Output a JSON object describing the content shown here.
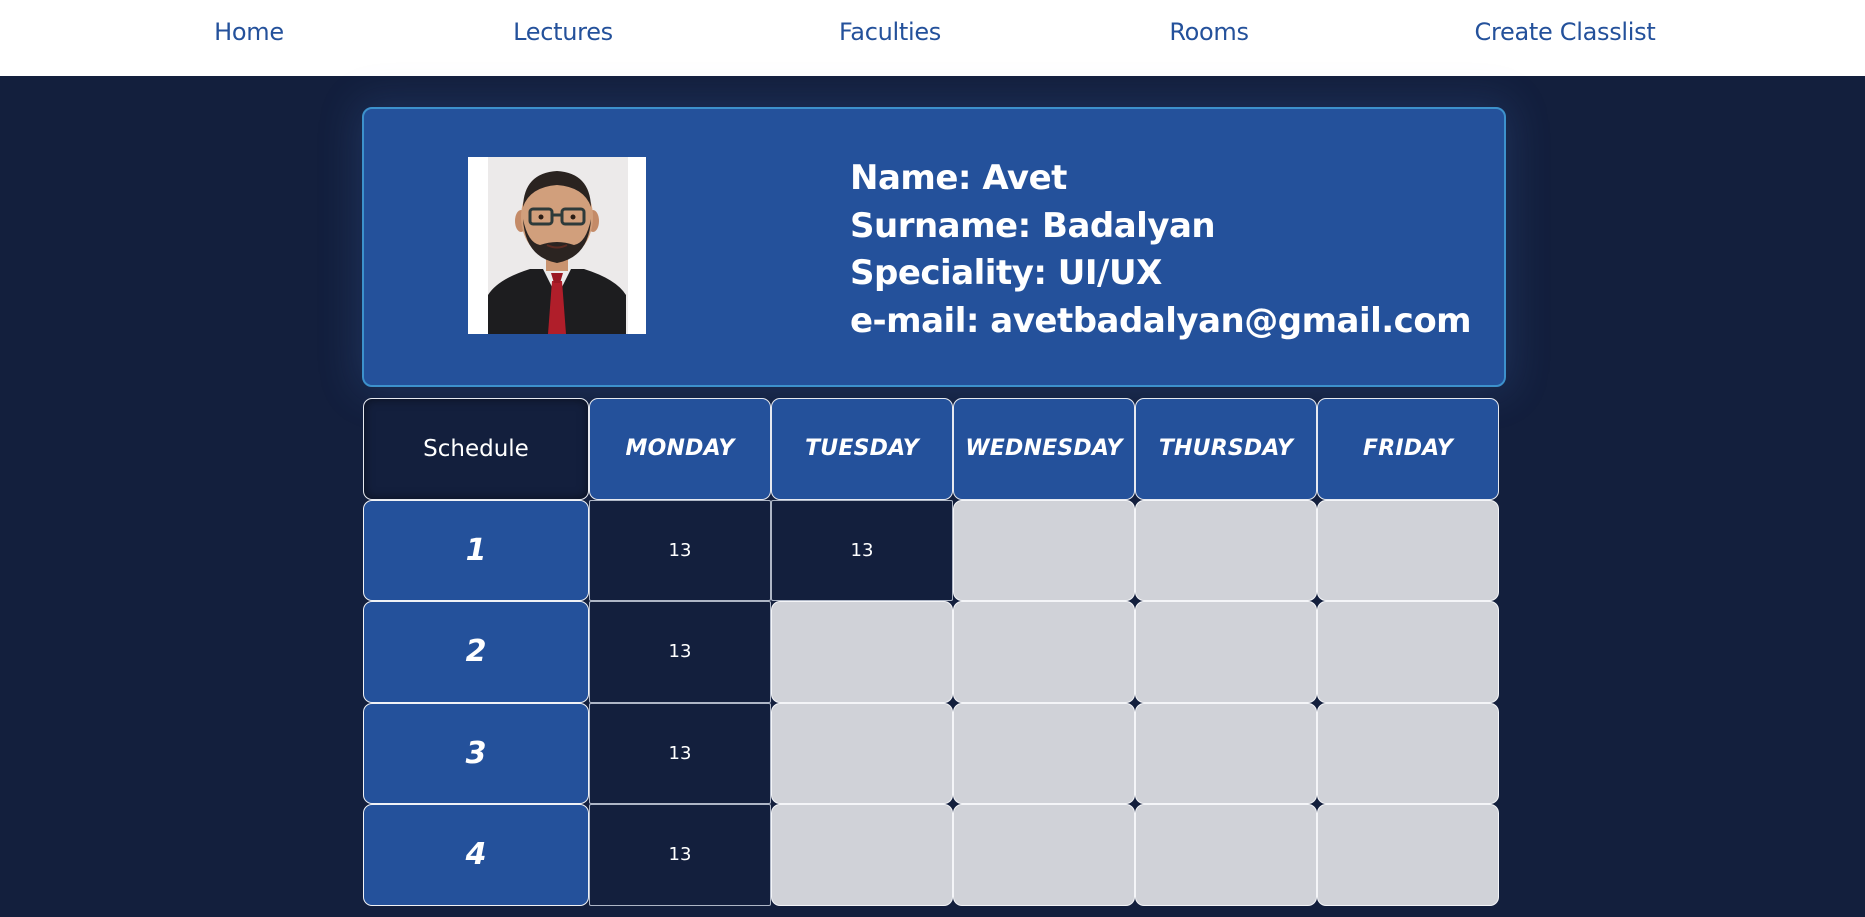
{
  "nav": {
    "home": "Home",
    "lectures": "Lectures",
    "faculties": "Faculties",
    "rooms": "Rooms",
    "create_classlist": "Create Classlist"
  },
  "profile": {
    "avatar_icon": "person-photo",
    "name_line": "Name: Avet",
    "surname_line": "Surname: Badalyan",
    "speciality_line": "Speciality: UI/UX",
    "email_line": "e-mail: avetbadalyan@gmail.com"
  },
  "schedule": {
    "corner_label": "Schedule",
    "days": [
      "MONDAY",
      "TUESDAY",
      "WEDNESDAY",
      "THURSDAY",
      "FRIDAY"
    ],
    "rows": [
      {
        "label": "1",
        "cells": [
          "13",
          "13",
          "",
          "",
          ""
        ]
      },
      {
        "label": "2",
        "cells": [
          "13",
          "",
          "",
          "",
          ""
        ]
      },
      {
        "label": "3",
        "cells": [
          "13",
          "",
          "",
          "",
          ""
        ]
      },
      {
        "label": "4",
        "cells": [
          "13",
          "",
          "",
          "",
          ""
        ]
      }
    ]
  },
  "colors": {
    "page_background": "#131f3d",
    "accent_blue": "#24519b",
    "empty_slot": "#d0d2d8",
    "nav_text": "#24519b"
  }
}
